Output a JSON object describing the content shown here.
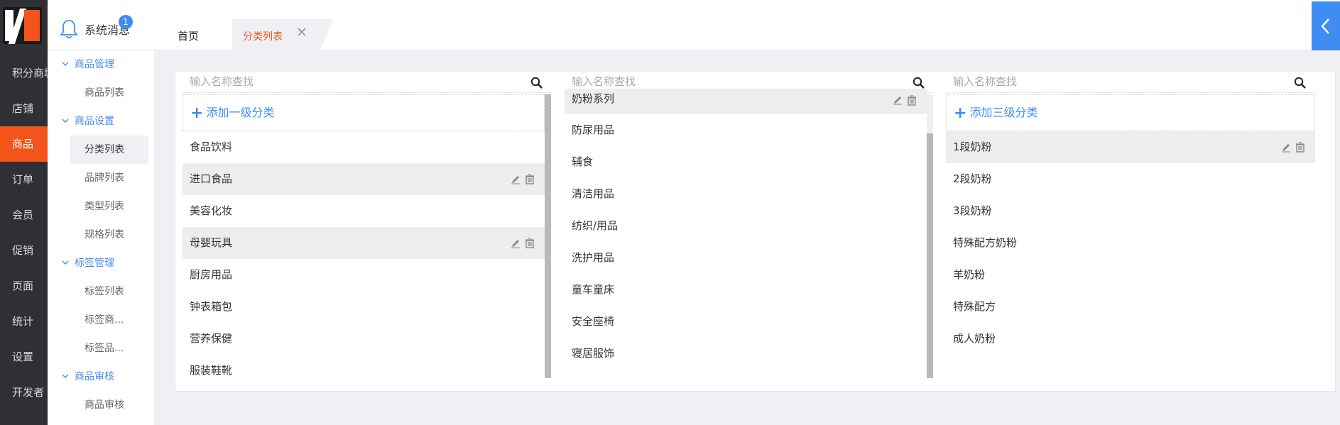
{
  "sidebar": {
    "items": [
      {
        "label": "积分商城",
        "active": false
      },
      {
        "label": "店铺",
        "active": false
      },
      {
        "label": "商品",
        "active": true
      },
      {
        "label": "订单",
        "active": false
      },
      {
        "label": "会员",
        "active": false
      },
      {
        "label": "促销",
        "active": false
      },
      {
        "label": "页面",
        "active": false
      },
      {
        "label": "统计",
        "active": false
      },
      {
        "label": "设置",
        "active": false
      },
      {
        "label": "开发者",
        "active": false
      }
    ]
  },
  "header": {
    "messages_label": "系统消息",
    "messages_count": "1",
    "tabs": [
      {
        "label": "首页"
      },
      {
        "label": "分类列表"
      }
    ]
  },
  "subnav": {
    "groups": [
      {
        "label": "商品管理",
        "items": [
          {
            "label": "商品列表",
            "active": false
          }
        ]
      },
      {
        "label": "商品设置",
        "items": [
          {
            "label": "分类列表",
            "active": true
          },
          {
            "label": "品牌列表",
            "active": false
          },
          {
            "label": "类型列表",
            "active": false
          },
          {
            "label": "规格列表",
            "active": false
          }
        ]
      },
      {
        "label": "标签管理",
        "items": [
          {
            "label": "标签列表",
            "active": false
          },
          {
            "label": "标签商...",
            "active": false
          },
          {
            "label": "标签品...",
            "active": false
          }
        ]
      },
      {
        "label": "商品审核",
        "items": [
          {
            "label": "商品审核",
            "active": false
          }
        ]
      }
    ]
  },
  "columns": [
    {
      "placeholder": "输入名称查找",
      "add_label": "添加一级分类",
      "items": [
        {
          "label": "食品饮料",
          "highlighted": false
        },
        {
          "label": "进口食品",
          "highlighted": true
        },
        {
          "label": "美容化妆",
          "highlighted": false
        },
        {
          "label": "母婴玩具",
          "highlighted": true
        },
        {
          "label": "厨房用品",
          "highlighted": false
        },
        {
          "label": "钟表箱包",
          "highlighted": false
        },
        {
          "label": "营养保健",
          "highlighted": false
        },
        {
          "label": "服装鞋靴",
          "highlighted": false
        }
      ]
    },
    {
      "placeholder": "输入名称查找",
      "add_label": "",
      "items": [
        {
          "label": "奶粉系列",
          "highlighted": true
        },
        {
          "label": "防尿用品",
          "highlighted": false
        },
        {
          "label": "辅食",
          "highlighted": false
        },
        {
          "label": "清洁用品",
          "highlighted": false
        },
        {
          "label": "纺织/用品",
          "highlighted": false
        },
        {
          "label": "洗护用品",
          "highlighted": false
        },
        {
          "label": "童车童床",
          "highlighted": false
        },
        {
          "label": "安全座椅",
          "highlighted": false
        },
        {
          "label": "寝居服饰",
          "highlighted": false
        }
      ]
    },
    {
      "placeholder": "输入名称查找",
      "add_label": "添加三级分类",
      "items": [
        {
          "label": "1段奶粉",
          "highlighted": true
        },
        {
          "label": "2段奶粉",
          "highlighted": false
        },
        {
          "label": "3段奶粉",
          "highlighted": false
        },
        {
          "label": "特殊配方奶粉",
          "highlighted": false
        },
        {
          "label": "羊奶粉",
          "highlighted": false
        },
        {
          "label": "特殊配方",
          "highlighted": false
        },
        {
          "label": "成人奶粉",
          "highlighted": false
        }
      ]
    }
  ],
  "colors": {
    "accent": "#f2541b",
    "primary": "#3f8cf5",
    "sidebar_bg": "#2f3035"
  }
}
